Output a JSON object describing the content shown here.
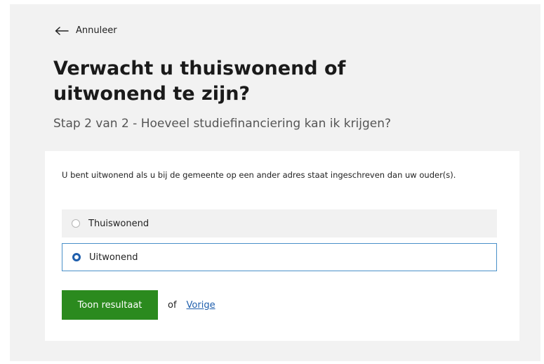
{
  "nav": {
    "back_label": "Annuleer"
  },
  "header": {
    "title": "Verwacht u thuiswonend of uitwonend te zijn?",
    "subtitle": "Stap 2 van 2 - Hoeveel studiefinanciering kan ik krijgen?"
  },
  "form": {
    "intro": "U bent uitwonend als u bij de gemeente op een ander adres staat ingeschreven dan uw ouder(s).",
    "options": [
      {
        "label": "Thuiswonend",
        "selected": false
      },
      {
        "label": "Uitwonend",
        "selected": true
      }
    ],
    "submit_label": "Toon resultaat",
    "or_text": "of",
    "previous_label": "Vorige"
  },
  "colors": {
    "page_background": "#f2f2f2",
    "card_background": "#ffffff",
    "primary_button": "#2b8a1e",
    "link": "#1f5fad",
    "selected_border": "#4a90c8"
  },
  "icons": {
    "back": "arrow-left-icon"
  }
}
